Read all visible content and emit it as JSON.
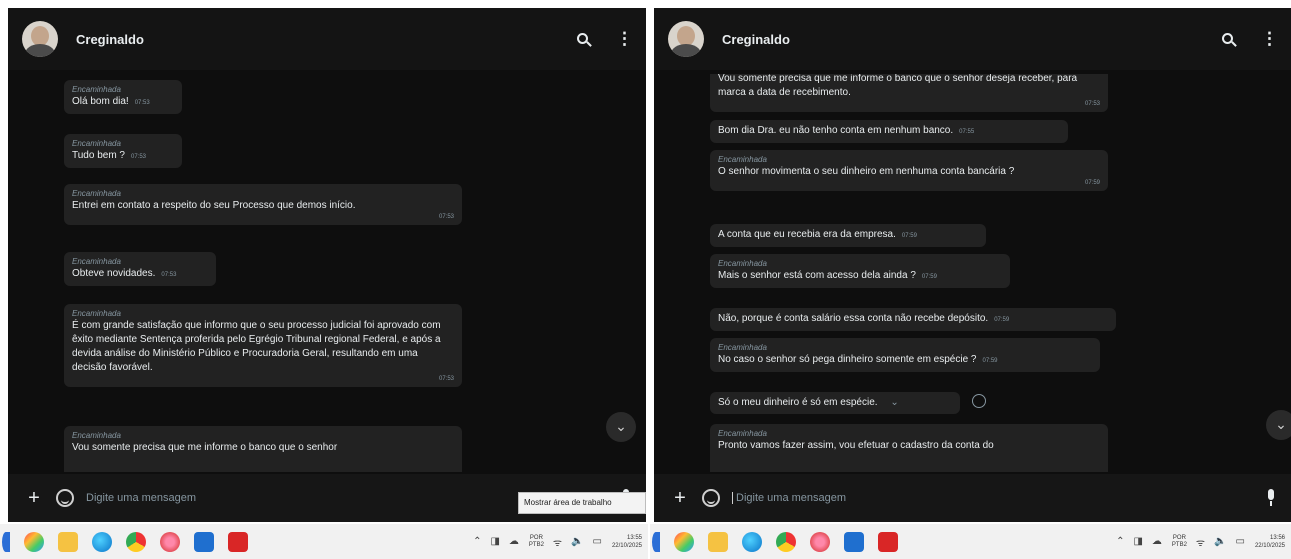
{
  "left": {
    "contact_name": "Creginaldo",
    "messages": [
      {
        "forwarded": "Encaminhada",
        "text": "Olá bom dia!",
        "time": "07:53"
      },
      {
        "forwarded": "Encaminhada",
        "text": "Tudo bem ?",
        "time": "07:53"
      },
      {
        "forwarded": "Encaminhada",
        "text": "Entrei em contato a respeito do seu Processo que demos início.",
        "time": "07:53"
      },
      {
        "forwarded": "Encaminhada",
        "text": "Obteve novidades.",
        "time": "07:53"
      },
      {
        "forwarded": "Encaminhada",
        "text": "É com grande satisfação que informo que o seu processo judicial foi aprovado com êxito mediante Sentença proferida pelo Egrégio Tribunal regional Federal, e após a devida análise do Ministério Público e Procuradoria Geral, resultando em uma decisão favorável.",
        "time": "07:53"
      },
      {
        "forwarded": "Encaminhada",
        "text": "Vou somente precisa que me informe o banco que o senhor",
        "time": ""
      }
    ],
    "input_placeholder": "Digite uma mensagem",
    "tooltip": "Mostrar área de trabalho",
    "clock_time": "13:55",
    "clock_date": "22/10/2025"
  },
  "right": {
    "contact_name": "Creginaldo",
    "messages": [
      {
        "forwarded": "",
        "text": "Vou somente precisa que me informe o banco que o senhor deseja receber, para marca a data de recebimento.",
        "time": "07:53"
      },
      {
        "forwarded": "",
        "text": "Bom dia Dra. eu não tenho conta em nenhum banco.",
        "time": "07:55"
      },
      {
        "forwarded": "Encaminhada",
        "text": "O senhor movimenta o seu dinheiro em nenhuma conta bancária ?",
        "time": "07:59"
      },
      {
        "forwarded": "",
        "text": "A conta que eu recebia era da empresa.",
        "time": "07:59"
      },
      {
        "forwarded": "Encaminhada",
        "text": "Mais o senhor está com acesso dela ainda ?",
        "time": "07:59"
      },
      {
        "forwarded": "",
        "text": "Não, porque é conta salário essa conta não recebe depósito.",
        "time": "07:59"
      },
      {
        "forwarded": "Encaminhada",
        "text": "No caso o senhor só pega dinheiro somente em espécie ?",
        "time": "07:59"
      },
      {
        "forwarded": "",
        "text": "Só o meu dinheiro é só em espécie.",
        "time": ""
      },
      {
        "forwarded": "Encaminhada",
        "text": "Pronto vamos fazer assim, vou efetuar o cadastro da conta do",
        "time": ""
      }
    ],
    "input_placeholder": "Digite uma mensagem",
    "clock_time": "13:56",
    "clock_date": "22/10/2025"
  },
  "tray": {
    "lang_top": "POR",
    "lang_bottom": "PTB2"
  },
  "colors": {
    "chat_bg": "#0e0e0e",
    "bubble_bg": "#222222",
    "header_bg": "#141414",
    "text": "#e9edef",
    "meta": "#8696a0"
  },
  "icons": [
    "search-icon",
    "menu-icon",
    "plus-icon",
    "emoji-icon",
    "mic-icon",
    "chevron-down-icon"
  ]
}
